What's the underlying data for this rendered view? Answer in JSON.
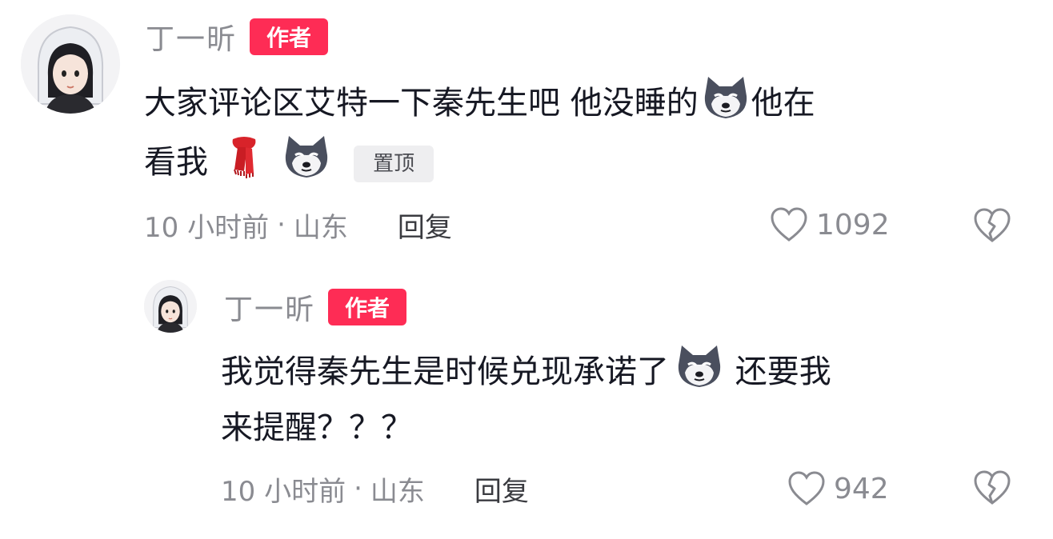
{
  "comments": [
    {
      "username": "丁一昕",
      "badge": "作者",
      "text_line1": "大家评论区艾特一下秦先生吧 他没睡的",
      "text_line1_after": "他在",
      "text_line2": "看我",
      "pinned_label": "置顶",
      "time": "10 小时前",
      "location": "山东",
      "reply_label": "回复",
      "likes": "1092"
    },
    {
      "username": "丁一昕",
      "badge": "作者",
      "text_line1": "我觉得秦先生是时候兑现承诺了",
      "text_line1_after": " 还要我",
      "text_line2": "来提醒？？？",
      "time": "10 小时前",
      "location": "山东",
      "reply_label": "回复",
      "likes": "942"
    }
  ],
  "separator": "·",
  "icons": {
    "heart": "heart-outline-icon",
    "dislike": "broken-heart-icon",
    "emoji_dog": "husky-emoji-icon",
    "emoji_scarf": "red-scarf-emoji-icon"
  },
  "colors": {
    "badge": "#fe2c55",
    "meta": "#8a8b91",
    "text": "#161823"
  }
}
